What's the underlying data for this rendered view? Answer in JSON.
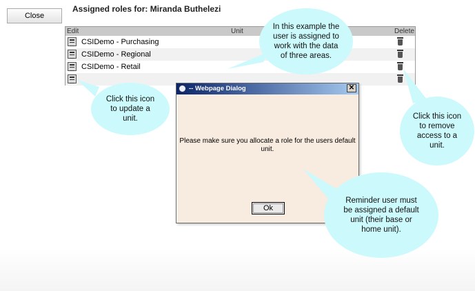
{
  "toolbar": {
    "close_label": "Close"
  },
  "page": {
    "title": "Assigned roles for: Miranda Buthelezi"
  },
  "grid": {
    "headers": {
      "edit": "Edit",
      "unit": "Unit",
      "delete": "Delete"
    },
    "rows": [
      {
        "unit": "CSIDemo - Purchasing"
      },
      {
        "unit": "CSIDemo - Regional"
      },
      {
        "unit": "CSIDemo - Retail"
      },
      {
        "unit": ""
      }
    ]
  },
  "dialog": {
    "title": "-- Webpage Dialog",
    "message_line1": "Please make sure you allocate a role for the users default",
    "message_line2": "unit.",
    "ok_label": "Ok",
    "close_glyph": "✕"
  },
  "callouts": {
    "example": "In this example the user is assigned to work with the data of three areas.",
    "edit_icon": "Click this icon to update a unit.",
    "delete_icon": "Click this icon to remove access to a unit.",
    "reminder": "Reminder user must be assigned a default unit (their base or home unit)."
  },
  "colors": {
    "callout_fill": "#ccf9fb",
    "dialog_title_start": "#0a246a",
    "dialog_bg": "#f8ebe0"
  }
}
